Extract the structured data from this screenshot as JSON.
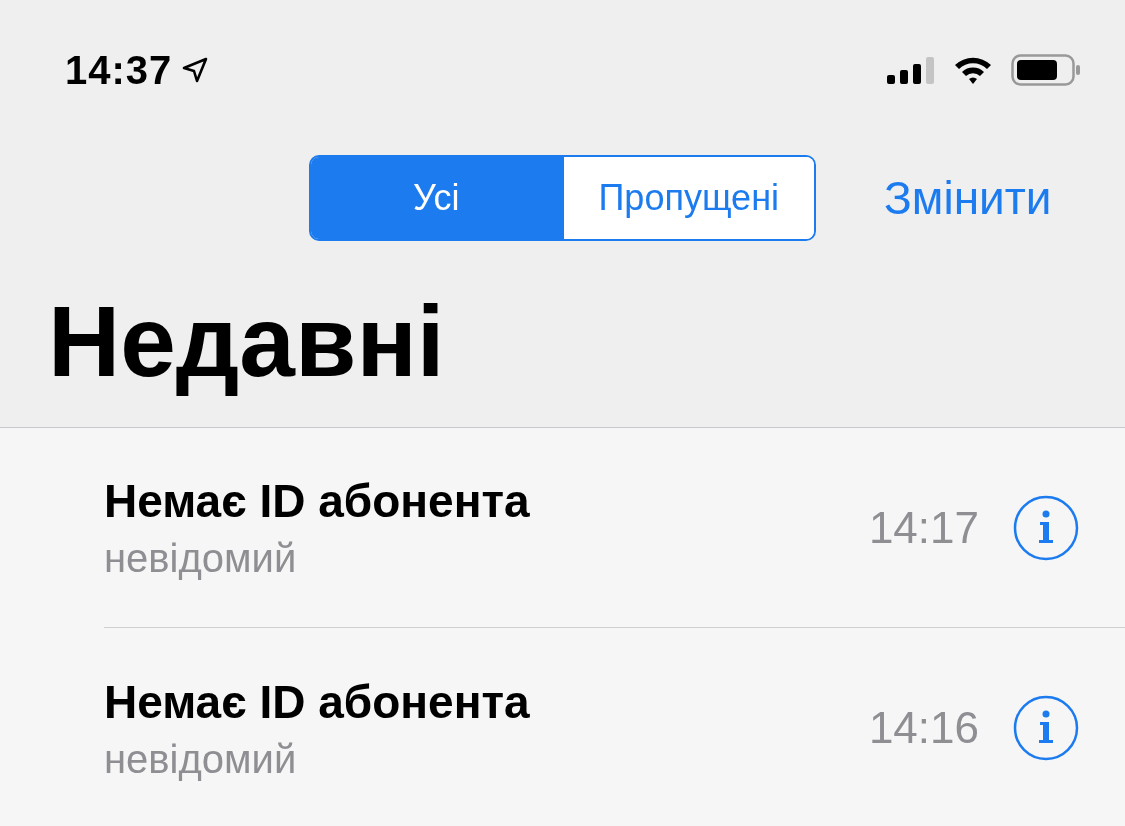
{
  "status_bar": {
    "time": "14:37"
  },
  "segments": [
    {
      "label": "Усі",
      "selected": true
    },
    {
      "label": "Пропущені",
      "selected": false
    }
  ],
  "edit_button": {
    "label": "Змінити"
  },
  "title": "Недавні",
  "calls": [
    {
      "name": "Немає ID абонента",
      "detail": "невідомий",
      "time": "14:17"
    },
    {
      "name": "Немає ID абонента",
      "detail": "невідомий",
      "time": "14:16"
    }
  ]
}
